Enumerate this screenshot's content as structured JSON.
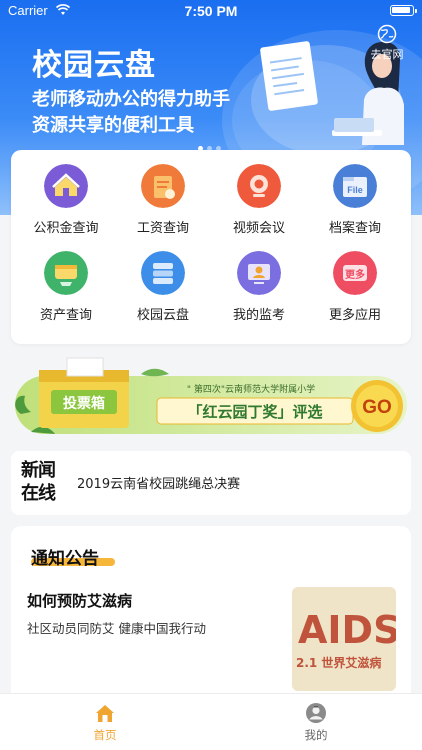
{
  "status_bar": {
    "carrier": "Carrier",
    "time": "7:50 PM"
  },
  "hero": {
    "title": "校园云盘",
    "line1": "老师移动办公的得力助手",
    "line2": "资源共享的便利工具",
    "globe_label": "去官网"
  },
  "apps": [
    {
      "label": "公积金查询",
      "icon": "house-icon",
      "color": "#7b5cd6"
    },
    {
      "label": "工资查询",
      "icon": "salary-icon",
      "color": "#f07a3a"
    },
    {
      "label": "视频会议",
      "icon": "video-meeting-icon",
      "color": "#ef5a3c"
    },
    {
      "label": "档案查询",
      "icon": "file-icon",
      "color": "#4a7fd8"
    },
    {
      "label": "资产查询",
      "icon": "asset-icon",
      "color": "#3fb36a"
    },
    {
      "label": "校园云盘",
      "icon": "cloud-disk-icon",
      "color": "#3d8ee8"
    },
    {
      "label": "我的监考",
      "icon": "invigilate-icon",
      "color": "#7a6ee0"
    },
    {
      "label": "更多应用",
      "icon": "more-apps-icon",
      "color": "#ef4d62"
    }
  ],
  "vote_banner": {
    "box_label": "投票箱",
    "subtitle": "\" 第四次\"云南师范大学附属小学",
    "award": "「红云园丁奖」评选",
    "go": "GO"
  },
  "news": {
    "logo_line1": "新闻",
    "logo_line2": "在线",
    "headline": "2019云南省校园跳绳总决赛"
  },
  "notice": {
    "heading": "通知公告",
    "title": "如何预防艾滋病",
    "subtitle": "社区动员同防艾   健康中国我行动",
    "thumb_big": "AIDS",
    "thumb_caption": "2.1 世界艾滋病"
  },
  "tabs": [
    {
      "label": "首页",
      "icon": "home-icon",
      "active": true
    },
    {
      "label": "我的",
      "icon": "profile-icon",
      "active": false
    }
  ],
  "colors": {
    "primary_blue": "#1a6ef0",
    "tab_active": "#f0a531",
    "notice_accent": "#f5b63a"
  }
}
